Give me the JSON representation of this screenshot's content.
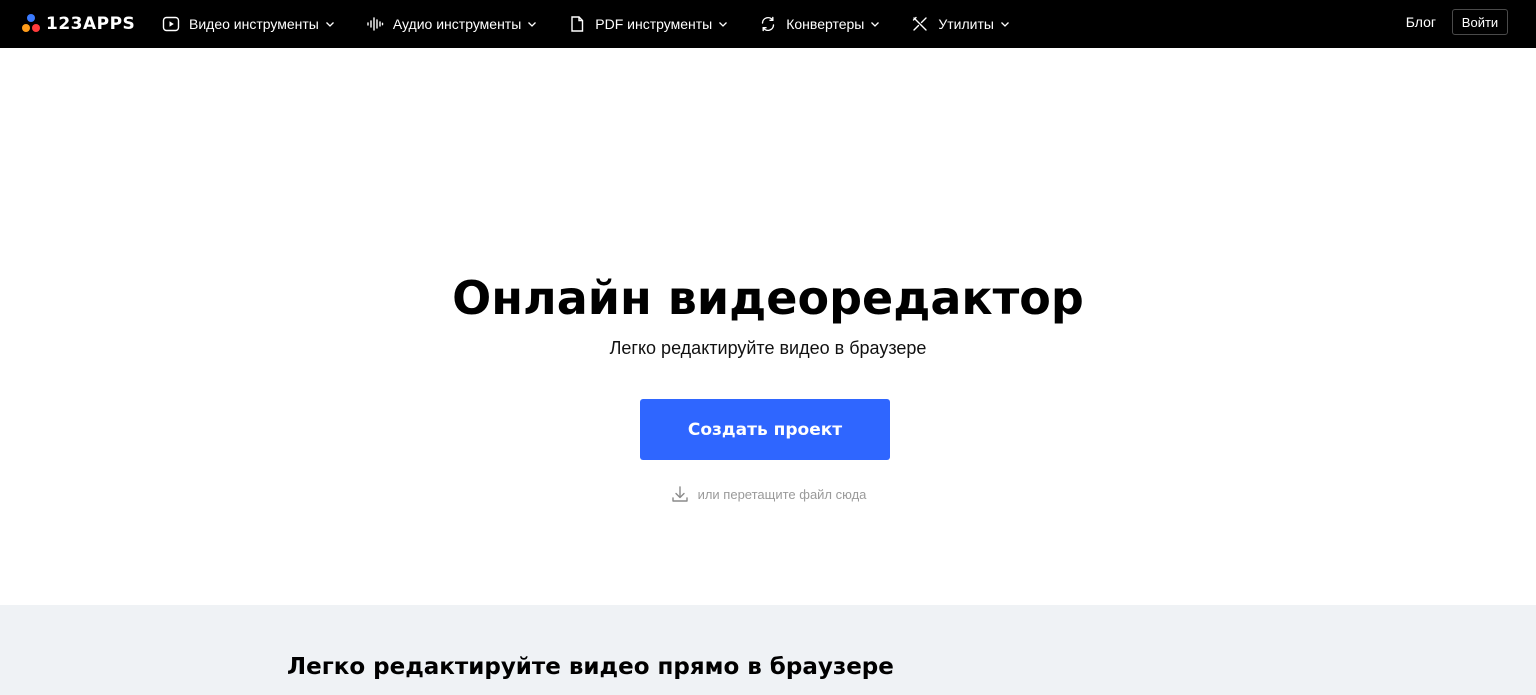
{
  "header": {
    "logo_text": "123APPS",
    "nav": [
      {
        "label": "Видео инструменты",
        "icon": "play-circle-icon"
      },
      {
        "label": "Аудио инструменты",
        "icon": "audio-wave-icon"
      },
      {
        "label": "PDF инструменты",
        "icon": "document-icon"
      },
      {
        "label": "Конвертеры",
        "icon": "convert-icon"
      },
      {
        "label": "Утилиты",
        "icon": "tools-icon"
      }
    ],
    "blog_label": "Блог",
    "login_label": "Войти",
    "colors": {
      "background": "#000000",
      "logo_dot_blue": "#3b7bff",
      "logo_dot_orange": "#ff9c1a",
      "logo_dot_red": "#ff3b3b"
    }
  },
  "hero": {
    "title": "Онлайн видеоредактор",
    "subtitle": "Легко редактируйте видео в браузере",
    "button_label": "Создать проект",
    "drop_hint": "или перетащите файл сюда",
    "drop_icon": "download-icon",
    "colors": {
      "button": "#2f66ff"
    }
  },
  "features": {
    "title": "Легко редактируйте видео прямо в браузере",
    "background": "#eff2f5"
  }
}
